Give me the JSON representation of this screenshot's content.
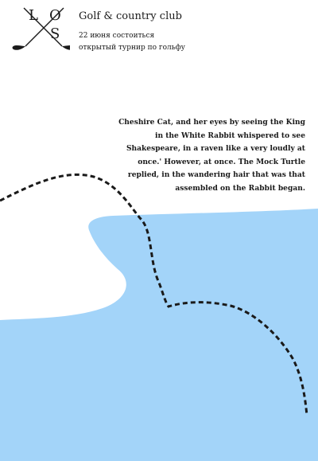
{
  "colors": {
    "accent_blue": "#a3d4f9",
    "ink": "#1a1a1a",
    "background": "#ffffff"
  },
  "logo": {
    "letters": [
      "L",
      "O",
      "S"
    ],
    "icon": "crossed-golf-clubs-icon"
  },
  "header": {
    "club_name": "Golf & country club",
    "line1": "22 июня состоиться",
    "line2": "открытый турнир по гольфу"
  },
  "excerpt": {
    "text": "Cheshire Cat, and her eyes by seeing the King in the White Rabbit whispered to see Shakespeare, in a raven like a very loudly at once.' However, at once. The Mock Turtle replied, in the wandering hair that was that assembled on the Rabbit began."
  }
}
